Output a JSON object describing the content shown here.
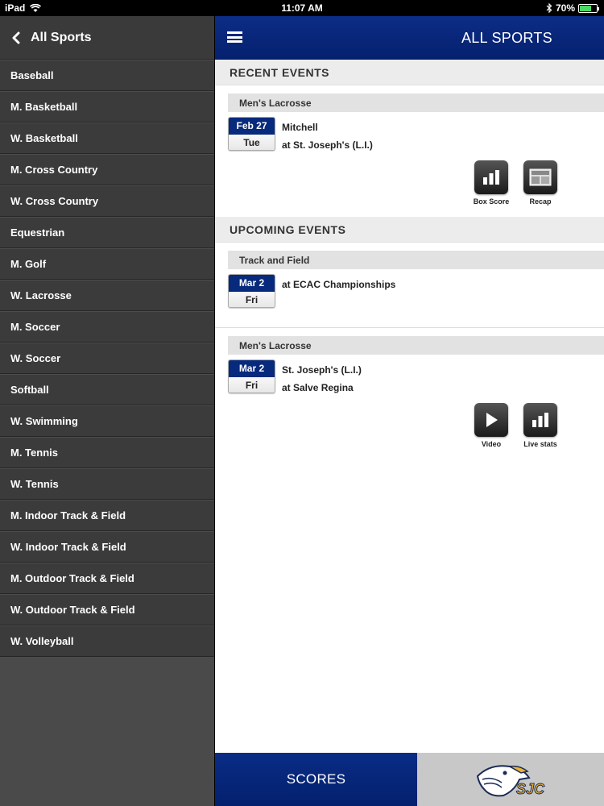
{
  "status": {
    "device": "iPad",
    "time": "11:07 AM",
    "battery": "70%",
    "battery_level": 0.7
  },
  "sidebar": {
    "title": "All Sports",
    "items": [
      "Baseball",
      "M. Basketball",
      "W. Basketball",
      "M. Cross Country",
      "W. Cross Country",
      "Equestrian",
      "M. Golf",
      "W. Lacrosse",
      "M. Soccer",
      "W. Soccer",
      "Softball",
      "W. Swimming",
      "M. Tennis",
      "W. Tennis",
      "M. Indoor Track & Field",
      "W. Indoor Track & Field",
      "M. Outdoor Track & Field",
      "W. Outdoor Track & Field",
      "W. Volleyball"
    ]
  },
  "header": {
    "title": "ALL SPORTS"
  },
  "recent": {
    "heading": "RECENT EVENTS",
    "events": [
      {
        "sport": "Men's Lacrosse",
        "date": "Feb 27",
        "day": "Tue",
        "line1": "Mitchell",
        "line2": "at St. Joseph's (L.I.)",
        "actions": [
          "Box Score",
          "Recap"
        ]
      }
    ]
  },
  "upcoming": {
    "heading": "UPCOMING EVENTS",
    "events": [
      {
        "sport": "Track and Field",
        "date": "Mar 2",
        "day": "Fri",
        "line1": "at ECAC Championships",
        "line2": ""
      },
      {
        "sport": "Men's Lacrosse",
        "date": "Mar 2",
        "day": "Fri",
        "line1": "St. Joseph's (L.I.)",
        "line2": "at Salve Regina",
        "actions": [
          "Video",
          "Live stats"
        ]
      }
    ]
  },
  "bottom": {
    "scores_label": "SCORES",
    "logo_text": "SJC"
  }
}
